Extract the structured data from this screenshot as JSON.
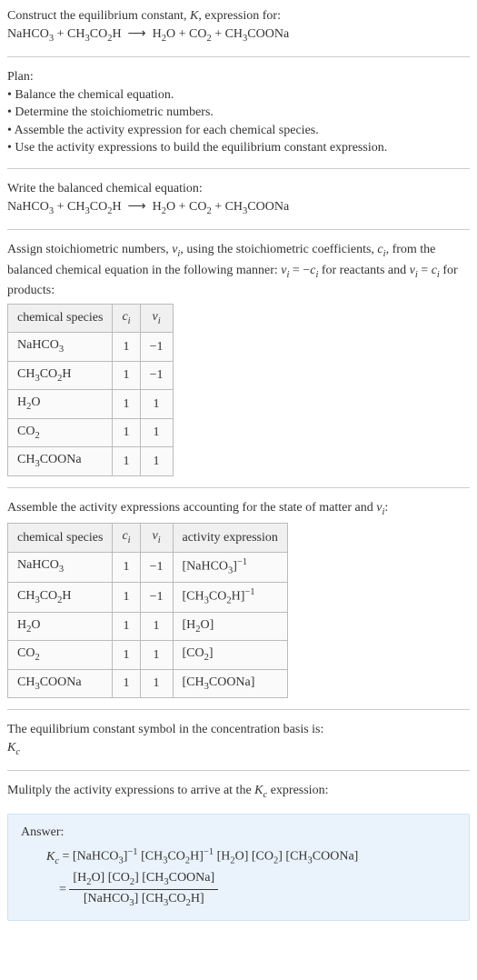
{
  "header": {
    "title_prefix": "Construct the equilibrium constant, ",
    "title_k": "K",
    "title_suffix": ", expression for:",
    "equation_html": "NaHCO<sub>3</sub> + CH<sub>3</sub>CO<sub>2</sub>H &nbsp;⟶&nbsp; H<sub>2</sub>O + CO<sub>2</sub> + CH<sub>3</sub>COONa"
  },
  "plan": {
    "label": "Plan:",
    "items": [
      "Balance the chemical equation.",
      "Determine the stoichiometric numbers.",
      "Assemble the activity expression for each chemical species.",
      "Use the activity expressions to build the equilibrium constant expression."
    ]
  },
  "balanced": {
    "label": "Write the balanced chemical equation:",
    "equation_html": "NaHCO<sub>3</sub> + CH<sub>3</sub>CO<sub>2</sub>H &nbsp;⟶&nbsp; H<sub>2</sub>O + CO<sub>2</sub> + CH<sub>3</sub>COONa"
  },
  "stoich": {
    "intro_html": "Assign stoichiometric numbers, <span class=\"italic\">ν<sub>i</sub></span>, using the stoichiometric coefficients, <span class=\"italic\">c<sub>i</sub></span>, from the balanced chemical equation in the following manner: <span class=\"italic\">ν<sub>i</sub></span> = −<span class=\"italic\">c<sub>i</sub></span> for reactants and <span class=\"italic\">ν<sub>i</sub></span> = <span class=\"italic\">c<sub>i</sub></span> for products:",
    "headers": {
      "species": "chemical species",
      "ci_html": "<span class=\"italic\">c<sub>i</sub></span>",
      "vi_html": "<span class=\"italic\">ν<sub>i</sub></span>"
    },
    "rows": [
      {
        "species_html": "NaHCO<sub>3</sub>",
        "ci": "1",
        "vi": "−1"
      },
      {
        "species_html": "CH<sub>3</sub>CO<sub>2</sub>H",
        "ci": "1",
        "vi": "−1"
      },
      {
        "species_html": "H<sub>2</sub>O",
        "ci": "1",
        "vi": "1"
      },
      {
        "species_html": "CO<sub>2</sub>",
        "ci": "1",
        "vi": "1"
      },
      {
        "species_html": "CH<sub>3</sub>COONa",
        "ci": "1",
        "vi": "1"
      }
    ]
  },
  "activity": {
    "intro_html": "Assemble the activity expressions accounting for the state of matter and <span class=\"italic\">ν<sub>i</sub></span>:",
    "headers": {
      "species": "chemical species",
      "ci_html": "<span class=\"italic\">c<sub>i</sub></span>",
      "vi_html": "<span class=\"italic\">ν<sub>i</sub></span>",
      "activity": "activity expression"
    },
    "rows": [
      {
        "species_html": "NaHCO<sub>3</sub>",
        "ci": "1",
        "vi": "−1",
        "expr_html": "[NaHCO<sub>3</sub>]<sup>−1</sup>"
      },
      {
        "species_html": "CH<sub>3</sub>CO<sub>2</sub>H",
        "ci": "1",
        "vi": "−1",
        "expr_html": "[CH<sub>3</sub>CO<sub>2</sub>H]<sup>−1</sup>"
      },
      {
        "species_html": "H<sub>2</sub>O",
        "ci": "1",
        "vi": "1",
        "expr_html": "[H<sub>2</sub>O]"
      },
      {
        "species_html": "CO<sub>2</sub>",
        "ci": "1",
        "vi": "1",
        "expr_html": "[CO<sub>2</sub>]"
      },
      {
        "species_html": "CH<sub>3</sub>COONa",
        "ci": "1",
        "vi": "1",
        "expr_html": "[CH<sub>3</sub>COONa]"
      }
    ]
  },
  "symbol": {
    "label": "The equilibrium constant symbol in the concentration basis is:",
    "value_html": "<span class=\"italic\">K<sub>c</sub></span>"
  },
  "multiply": {
    "label_html": "Mulitply the activity expressions to arrive at the <span class=\"italic\">K<sub>c</sub></span> expression:"
  },
  "answer": {
    "label": "Answer:",
    "line1_html": "<span class=\"italic\">K<sub>c</sub></span> = [NaHCO<sub>3</sub>]<sup>−1</sup> [CH<sub>3</sub>CO<sub>2</sub>H]<sup>−1</sup> [H<sub>2</sub>O] [CO<sub>2</sub>] [CH<sub>3</sub>COONa]",
    "eq_sign": "= ",
    "numerator_html": "[H<sub>2</sub>O] [CO<sub>2</sub>] [CH<sub>3</sub>COONa]",
    "denominator_html": "[NaHCO<sub>3</sub>] [CH<sub>3</sub>CO<sub>2</sub>H]"
  }
}
